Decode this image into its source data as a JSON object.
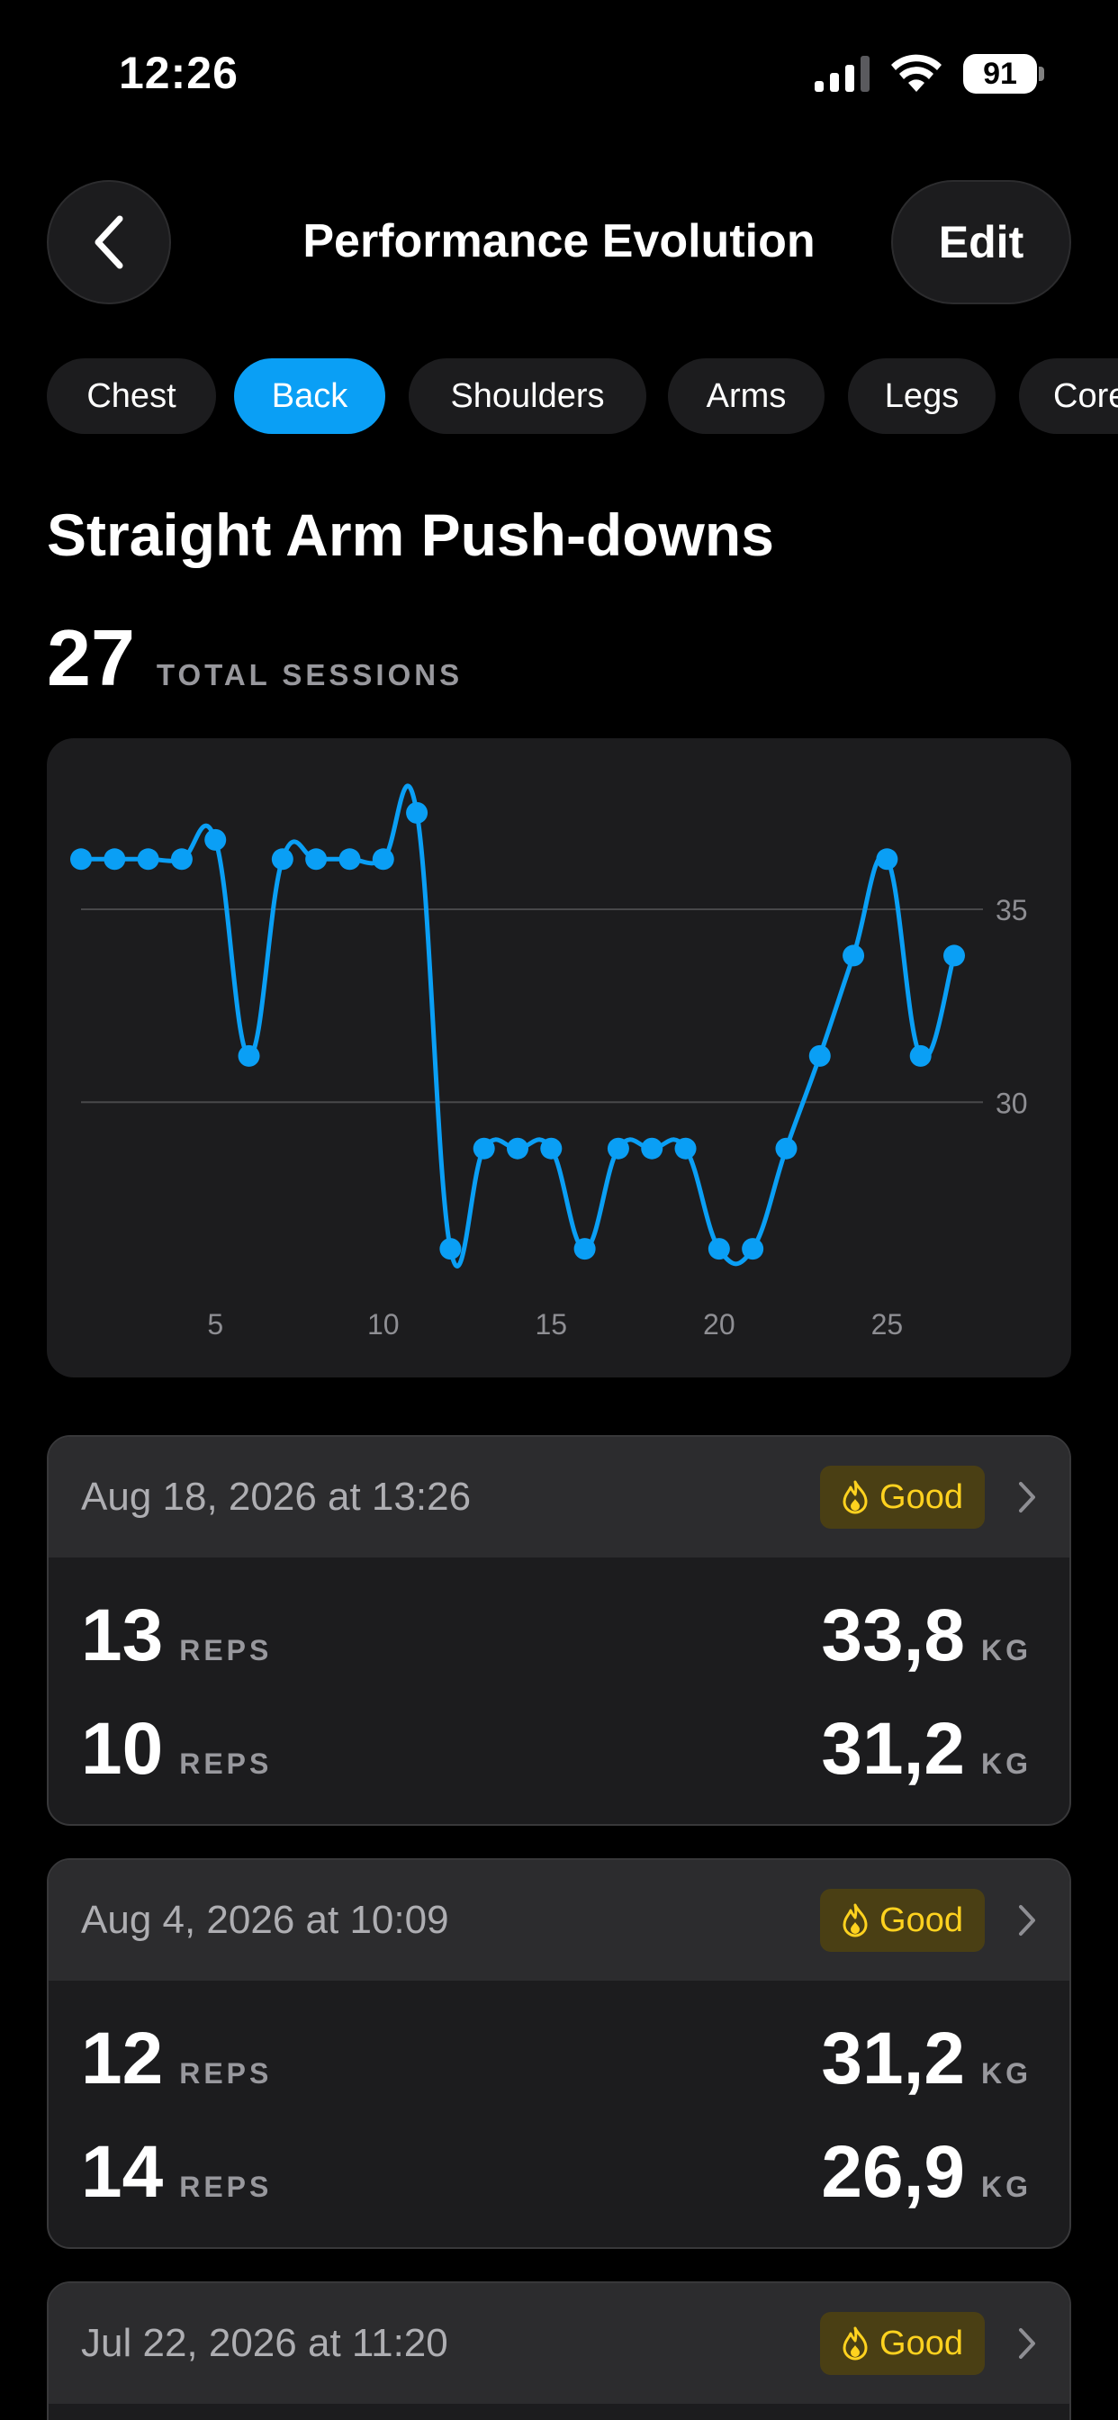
{
  "status_bar": {
    "time": "12:26",
    "battery": "91"
  },
  "nav": {
    "title": "Performance Evolution",
    "edit_label": "Edit"
  },
  "chips": [
    {
      "label": "Chest",
      "active": false
    },
    {
      "label": "Back",
      "active": true
    },
    {
      "label": "Shoulders",
      "active": false
    },
    {
      "label": "Arms",
      "active": false
    },
    {
      "label": "Legs",
      "active": false
    },
    {
      "label": "Core",
      "active": false
    }
  ],
  "exercise": {
    "title": "Straight Arm Push-downs",
    "total_sessions": "27",
    "total_sessions_label": "TOTAL SESSIONS"
  },
  "chart_data": {
    "type": "line",
    "x": [
      1,
      2,
      3,
      4,
      5,
      6,
      7,
      8,
      9,
      10,
      11,
      12,
      13,
      14,
      15,
      16,
      17,
      18,
      19,
      20,
      21,
      22,
      23,
      24,
      25,
      26,
      27
    ],
    "values": [
      36.3,
      36.3,
      36.3,
      36.3,
      36.8,
      31.2,
      36.3,
      36.3,
      36.3,
      36.3,
      37.5,
      26.2,
      28.8,
      28.8,
      28.8,
      26.2,
      28.8,
      28.8,
      28.8,
      26.2,
      26.2,
      28.8,
      31.2,
      33.8,
      36.3,
      31.2,
      33.8
    ],
    "xticks": [
      5,
      10,
      15,
      20,
      25
    ],
    "yticks": [
      30,
      35
    ],
    "ylim": [
      24.5,
      38.5
    ],
    "xlim": [
      1,
      27
    ],
    "grid": true,
    "color": "#0a9ff5"
  },
  "sessions": [
    {
      "date": "Aug 18, 2026 at 13:26",
      "badge": "Good",
      "sets": [
        {
          "reps": "13",
          "reps_unit": "REPS",
          "weight": "33,8",
          "weight_unit": "KG"
        },
        {
          "reps": "10",
          "reps_unit": "REPS",
          "weight": "31,2",
          "weight_unit": "KG"
        }
      ]
    },
    {
      "date": "Aug 4, 2026 at 10:09",
      "badge": "Good",
      "sets": [
        {
          "reps": "12",
          "reps_unit": "REPS",
          "weight": "31,2",
          "weight_unit": "KG"
        },
        {
          "reps": "14",
          "reps_unit": "REPS",
          "weight": "26,9",
          "weight_unit": "KG"
        }
      ]
    },
    {
      "date": "Jul 22, 2026 at 11:20",
      "badge": "Good",
      "sets": []
    }
  ],
  "colors": {
    "accent": "#0a9ff5",
    "badge_text": "#ffd21f",
    "badge_bg": "#4a3f14",
    "card": "#1c1c1e"
  }
}
